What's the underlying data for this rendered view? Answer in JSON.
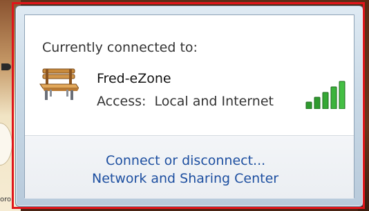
{
  "popup": {
    "heading": "Currently connected to:",
    "network": {
      "name": "Fred-eZone",
      "access_label": "Access:",
      "access_value": "Local and Internet",
      "icon": "bench-icon",
      "signal_icon": "signal-strength-icon",
      "signal_level": 1.0
    },
    "links": {
      "connect_disconnect": "Connect or disconnect...",
      "network_sharing_center": "Network and Sharing Center"
    }
  },
  "background": {
    "partial_text": "oro"
  },
  "colors": {
    "highlight": "#e0161b",
    "link": "#1d4fa0",
    "signal": "#2e9a2e"
  }
}
